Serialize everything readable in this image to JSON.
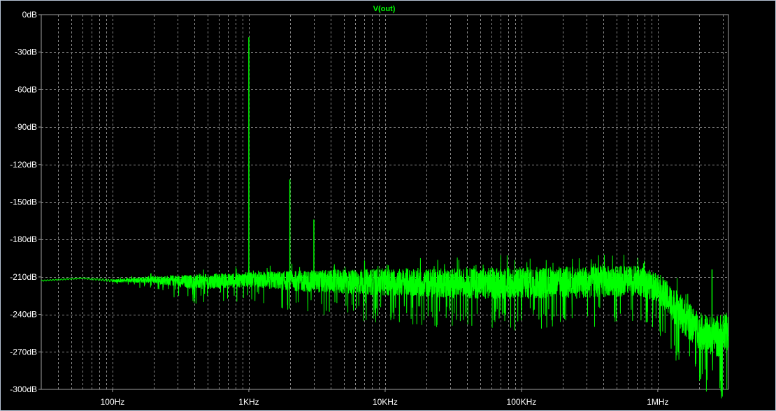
{
  "chart_data": {
    "type": "line",
    "title": "V(out)",
    "xlabel": "",
    "ylabel": "",
    "x_scale": "log",
    "xlim": [
      30,
      3300000
    ],
    "ylim": [
      -300,
      0
    ],
    "grid": true,
    "x_tick_labels": [
      {
        "value": 100,
        "label": "100Hz"
      },
      {
        "value": 1000,
        "label": "1KHz"
      },
      {
        "value": 10000,
        "label": "10KHz"
      },
      {
        "value": 100000,
        "label": "100KHz"
      },
      {
        "value": 1000000,
        "label": "1MHz"
      }
    ],
    "y_ticks": [
      0,
      -30,
      -60,
      -90,
      -120,
      -150,
      -180,
      -210,
      -240,
      -270,
      -300
    ],
    "y_tick_labels": [
      "0dB",
      "-30dB",
      "-60dB",
      "-90dB",
      "-120dB",
      "-150dB",
      "-180dB",
      "-210dB",
      "-240dB",
      "-270dB",
      "-300dB"
    ],
    "series": [
      {
        "name": "V(out)",
        "color": "#00ff00",
        "floor": {
          "x": [
            30,
            60,
            100,
            200,
            400,
            700,
            1000,
            2000,
            5000,
            10000,
            30000,
            100000,
            300000,
            700000,
            1000000,
            1500000,
            2000000,
            2500000,
            3300000
          ],
          "center": [
            -213,
            -211,
            -213,
            -212,
            -214,
            -213,
            -212,
            -213,
            -214,
            -214,
            -215,
            -215,
            -214,
            -213,
            -218,
            -240,
            -253,
            -258,
            -256
          ],
          "spread": [
            0.5,
            0.5,
            1,
            3,
            6,
            6,
            6,
            8,
            10,
            11,
            12,
            13,
            13,
            12,
            12,
            15,
            15,
            16,
            18
          ]
        },
        "peaks": [
          {
            "x": 1000,
            "y": -18
          },
          {
            "x": 2000,
            "y": -132
          },
          {
            "x": 3000,
            "y": -164
          },
          {
            "x": 2500000,
            "y": -204
          }
        ]
      }
    ]
  }
}
